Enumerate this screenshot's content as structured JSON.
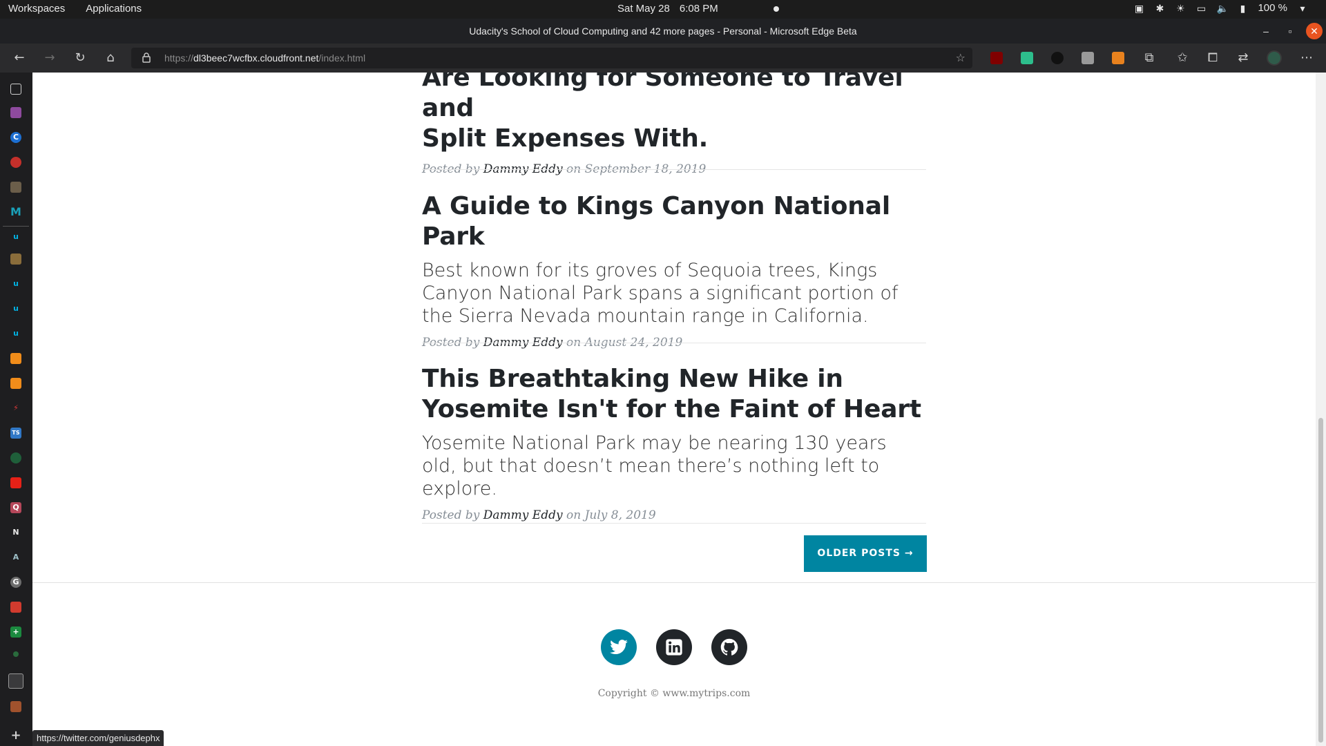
{
  "topbar": {
    "workspaces": "Workspaces",
    "applications": "Applications",
    "date": "Sat May 28",
    "time": "6:08 PM",
    "battery": "100 %"
  },
  "window": {
    "title": "Udacity's School of Cloud Computing and 42 more pages - Personal - Microsoft Edge Beta"
  },
  "address_bar": {
    "scheme": "https://",
    "host": "dl3beec7wcfbx.cloudfront.net",
    "path": "/index.html"
  },
  "posts": [
    {
      "title_line1": "Are Looking for Someone to Travel and",
      "title_line2": "Split Expenses With.",
      "posted_by": "Posted by",
      "author": "Dammy Eddy",
      "on": "on",
      "date": "September 18, 2019"
    },
    {
      "title": "A Guide to Kings Canyon National Park",
      "subtitle": "Best known for its groves of Sequoia trees, Kings Canyon National Park spans a significant portion of the Sierra Nevada mountain range in California.",
      "posted_by": "Posted by",
      "author": "Dammy Eddy",
      "on": "on",
      "date": "August 24, 2019"
    },
    {
      "title": "This Breathtaking New Hike in Yosemite Isn't for the Faint of Heart",
      "subtitle": "Yosemite National Park may be nearing 130 years old, but that doesn’t mean there’s nothing left to explore.",
      "posted_by": "Posted by",
      "author": "Dammy Eddy",
      "on": "on",
      "date": "July 8, 2019"
    }
  ],
  "pager": {
    "older_label": "OLDER POSTS →"
  },
  "footer": {
    "copyright": "Copyright © www.mytrips.com"
  },
  "status_bar": {
    "link": "https://twitter.com/geniusdephx"
  },
  "colors": {
    "accent": "#0085a1",
    "heading": "#212529",
    "meta": "#868e96",
    "social_dark": "#212529"
  },
  "icons": {
    "social": [
      "twitter-icon",
      "linkedin-icon",
      "github-icon"
    ]
  }
}
